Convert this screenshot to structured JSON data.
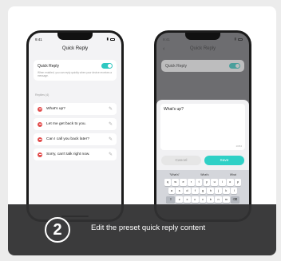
{
  "left_phone": {
    "status_time": "9:41",
    "nav_title": "Quick Reply",
    "toggle_label": "Quick Reply",
    "toggle_on": true,
    "description": "When enabled, you can reply quickly when your device receives a message.",
    "section_label": "Replies (4)",
    "replies": [
      "What's up?",
      "Let me get back to you.",
      "Can I call you back later?",
      "Sorry, can't talk right now."
    ]
  },
  "right_phone": {
    "status_time": "9:41",
    "nav_title": "Quick Reply",
    "toggle_label": "Quick Reply",
    "edit_text": "What's up?",
    "counter": "10/64",
    "cancel_label": "Cancel",
    "save_label": "Save",
    "suggestions": [
      "\"What's\"",
      "What's",
      "What"
    ],
    "keyboard_rows": [
      [
        "q",
        "w",
        "e",
        "r",
        "t",
        "y",
        "u",
        "i",
        "o",
        "p"
      ],
      [
        "a",
        "s",
        "d",
        "f",
        "g",
        "h",
        "j",
        "k",
        "l"
      ],
      [
        "⇧",
        "z",
        "x",
        "c",
        "v",
        "b",
        "n",
        "m",
        "⌫"
      ]
    ]
  },
  "step": {
    "number": "2",
    "caption": "Edit the preset quick reply content"
  },
  "colors": {
    "accent": "#2fc8c1",
    "delete": "#e24c4c",
    "overlay": "#303032"
  }
}
